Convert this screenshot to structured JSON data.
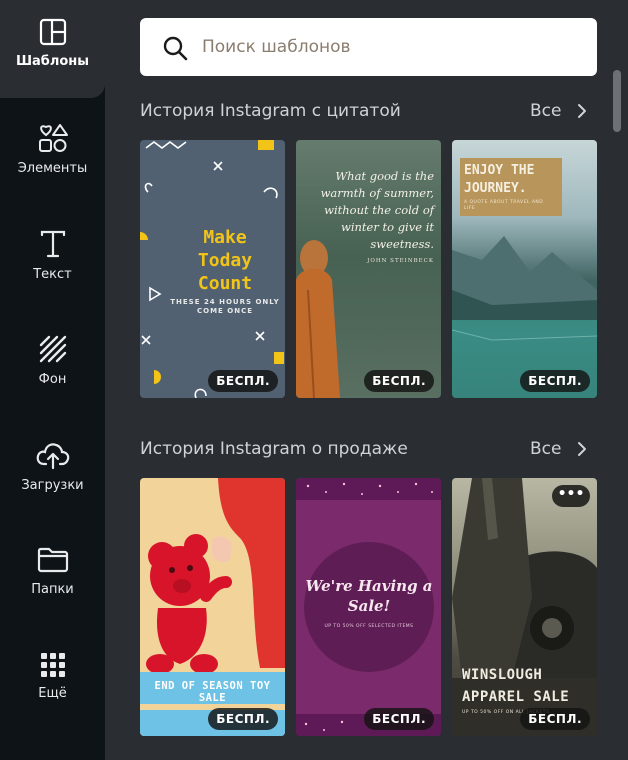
{
  "sidebar": {
    "items": [
      {
        "label": "Шаблоны",
        "icon": "templates-icon"
      },
      {
        "label": "Элементы",
        "icon": "elements-icon"
      },
      {
        "label": "Текст",
        "icon": "text-icon"
      },
      {
        "label": "Фон",
        "icon": "background-icon"
      },
      {
        "label": "Загрузки",
        "icon": "upload-icon"
      },
      {
        "label": "Папки",
        "icon": "folder-icon"
      },
      {
        "label": "Ещё",
        "icon": "more-grid-icon"
      }
    ],
    "active_index": 0
  },
  "search": {
    "placeholder": "Поиск шаблонов"
  },
  "sections": [
    {
      "title": "История Instagram с цитатой",
      "see_all": "Все",
      "cards": [
        {
          "lines": [
            "Make",
            "Today",
            "Count"
          ],
          "sub": "THESE 24 HOURS ONLY COME ONCE",
          "badge": "БЕСПЛ."
        },
        {
          "quote": "What good is the warmth of summer, without the cold of winter to give it sweetness.",
          "author": "JOHN STEINBECK",
          "badge": "БЕСПЛ."
        },
        {
          "title": "ENJOY THE JOURNEY.",
          "sub": "A QUOTE ABOUT TRAVEL AND LIFE",
          "badge": "БЕСПЛ."
        }
      ]
    },
    {
      "title": "История Instagram о продаже",
      "see_all": "Все",
      "cards": [
        {
          "banner": "END OF SEASON TOY SALE",
          "badge": "БЕСПЛ."
        },
        {
          "title": "We're Having a Sale!",
          "sub": "UP TO 50% OFF SELECTED ITEMS",
          "badge": "БЕСПЛ."
        },
        {
          "title": "WINSLOUGH APPAREL SALE",
          "sub": "UP TO 50% OFF ON ALL JACKETS",
          "more": "•••",
          "badge": "БЕСПЛ."
        }
      ]
    }
  ],
  "colors": {
    "sidebar_bg": "#0e1318",
    "panel_bg": "#2a2e33",
    "accent_yellow": "#f2c418"
  }
}
